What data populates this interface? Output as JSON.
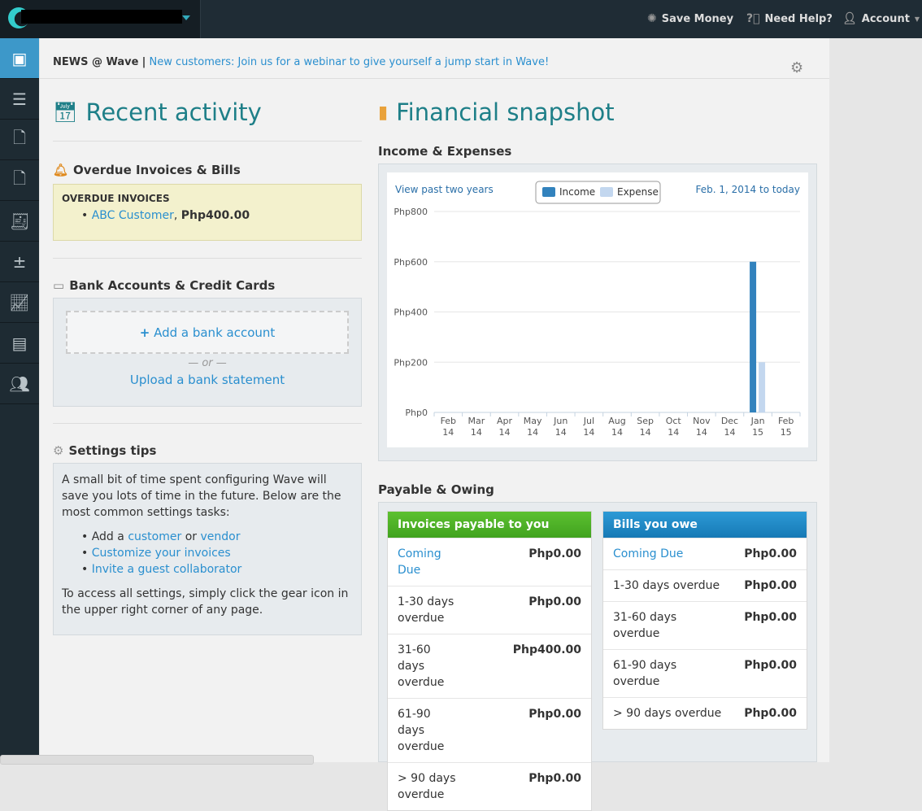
{
  "topbar": {
    "save_money": "Save Money",
    "need_help": "Need Help?",
    "account": "Account"
  },
  "news": {
    "label": "NEWS @ Wave",
    "separator": "|",
    "link": "New customers: Join us for a webinar to give yourself a jump start in Wave!"
  },
  "recent": {
    "title": "Recent activity",
    "overdue": {
      "title": "Overdue Invoices & Bills",
      "subtitle": "OVERDUE INVOICES",
      "customer": "ABC Customer",
      "amount": "Php400.00"
    },
    "bank": {
      "title": "Bank Accounts & Credit Cards",
      "add": "Add a bank account",
      "or": "— or —",
      "upload": "Upload a bank statement"
    },
    "tips": {
      "title": "Settings tips",
      "intro": "A small bit of time spent configuring Wave will save you lots of time in the future. Below are the most common settings tasks:",
      "add_a": "Add a",
      "customer": "customer",
      "or": "or",
      "vendor": "vendor",
      "customize": "Customize your invoices",
      "invite": "Invite a guest collaborator",
      "outro": "To access all settings, simply click the gear icon in the upper right corner of any page."
    }
  },
  "snapshot": {
    "title": "Financial snapshot",
    "income_title": "Income & Expenses",
    "view_past": "View past two years",
    "date_range": "Feb. 1, 2014 to today",
    "payable_title": "Payable & Owing",
    "invoices": {
      "title": "Invoices payable to you",
      "color": "#4cae2a",
      "rows": [
        {
          "label": "Coming Due",
          "amount": "Php0.00",
          "link": true
        },
        {
          "label": "1-30 days overdue",
          "amount": "Php0.00"
        },
        {
          "label": "31-60 days overdue",
          "amount": "Php400.00"
        },
        {
          "label": "61-90 days overdue",
          "amount": "Php0.00"
        },
        {
          "label": "> 90 days overdue",
          "amount": "Php0.00"
        }
      ]
    },
    "bills": {
      "title": "Bills you owe",
      "color": "#1e88c4",
      "rows": [
        {
          "label": "Coming Due",
          "amount": "Php0.00",
          "link": true
        },
        {
          "label": "1-30 days overdue",
          "amount": "Php0.00"
        },
        {
          "label": "31-60 days overdue",
          "amount": "Php0.00"
        },
        {
          "label": "61-90 days overdue",
          "amount": "Php0.00"
        },
        {
          "label": "> 90 days overdue",
          "amount": "Php0.00"
        }
      ]
    }
  },
  "chart_data": {
    "type": "bar",
    "categories": [
      "Feb 14",
      "Mar 14",
      "Apr 14",
      "May 14",
      "Jun 14",
      "Jul 14",
      "Aug 14",
      "Sep 14",
      "Oct 14",
      "Nov 14",
      "Dec 14",
      "Jan 15",
      "Feb 15"
    ],
    "series": [
      {
        "name": "Income",
        "color": "#3282bd",
        "values": [
          0,
          0,
          0,
          0,
          0,
          0,
          0,
          0,
          0,
          0,
          0,
          600,
          0
        ]
      },
      {
        "name": "Expense",
        "color": "#c3d7ef",
        "values": [
          0,
          0,
          0,
          0,
          0,
          0,
          0,
          0,
          0,
          0,
          0,
          200,
          0
        ]
      }
    ],
    "yticks": [
      "Php0",
      "Php200",
      "Php400",
      "Php600",
      "Php800"
    ],
    "ylim": [
      0,
      800
    ],
    "grid": true,
    "legend": "top-center"
  }
}
